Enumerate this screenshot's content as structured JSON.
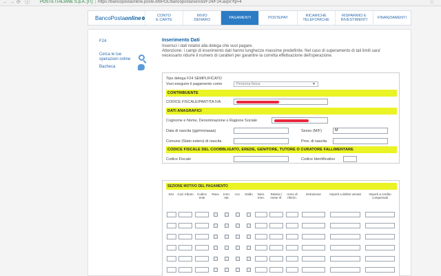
{
  "browser": {
    "back_icon": "back-arrow-icon",
    "forward_icon": "forward-arrow-icon",
    "site_id": "POSTE ITALIANE S.p.A. [IT]",
    "url": "https://bancopostaonline.poste.it/BPOL/bancoposta/servizi/F24/F24.aspx?tp=4",
    "bookmark_icon": "star-icon"
  },
  "topnav": {
    "logo_part1": "BancoPosta",
    "logo_part2": "online",
    "tabs": [
      {
        "label": "CONTO\nE CARTE"
      },
      {
        "label": "INVIO\nDENARO"
      },
      {
        "label": "PAGAMENTI"
      },
      {
        "label": "POSTEPAY"
      },
      {
        "label": "RICARICHE\nTELEFONICHE"
      },
      {
        "label": "RISPARMIO E\nINVESTIMENTI"
      },
      {
        "label": "FINANZIAMENTI"
      }
    ],
    "active_tab": "PAGAMENTI",
    "accent": "#2c7bc5"
  },
  "sidebar": {
    "f24": "F24",
    "search": "Cerca le tue operazioni online",
    "bacheca": "Bacheca"
  },
  "main": {
    "title": "Inserimento Dati",
    "intro1": "Inserisci i dati relativi alla delega che vuoi pagare.",
    "intro2": "Attenzione: i campi di inserimento dati hanno lunghezze massime predefinite. Nel caso di superamento di tali limiti sara'",
    "intro3": "necessario ridurre il numero di caratteri per garantire la corretta effettuazione dell'operazione."
  },
  "form": {
    "tipo_delega": "Tipo delega F24 SEMPLIFICATO",
    "pagamento_label": "Vuoi eseguire il pagamento come",
    "pagamento_value": "Persona fisica",
    "sec_contribuente": "CONTRIBUENTE",
    "cf_label": "CODICE FISCALE/PARTITA IVA",
    "sec_anagrafici": "DATI ANAGRAFICI",
    "cognome_label": "Cognome e Nome, Denominazione o Ragione Sociale",
    "nascita_label": "Data di nascita (gg/mm/aaaa)",
    "sesso_label": "Sesso (M/F)",
    "sesso_value": "M",
    "comune_label": "Comune (Stato estero) di nascita",
    "prov_label": "Prov. di nascita",
    "sec_coobbligato": "CODICE FISCALE DEL COOBBLIGATO, EREDE, GENITORE, TUTORE O CURATORE FALLIMENTARE",
    "cf2_label": "Codice Fiscale",
    "cod_id_label": "Codice Identificativo",
    "section_color": "#eaf324"
  },
  "motivo": {
    "title": "SEZIONE MOTIVO DEL PAGAMENTO",
    "columns": [
      "Sez.",
      "Cod. tributo",
      "Codice ente",
      "Ravv.",
      "Imm. Var.",
      "Acc.",
      "Saldo",
      "Num. Imm.",
      "Rateaz./ mese rif.",
      "Anno di riferim.",
      "Detrazione",
      "Importi a debito versati",
      "Importi a credito compensati"
    ]
  }
}
